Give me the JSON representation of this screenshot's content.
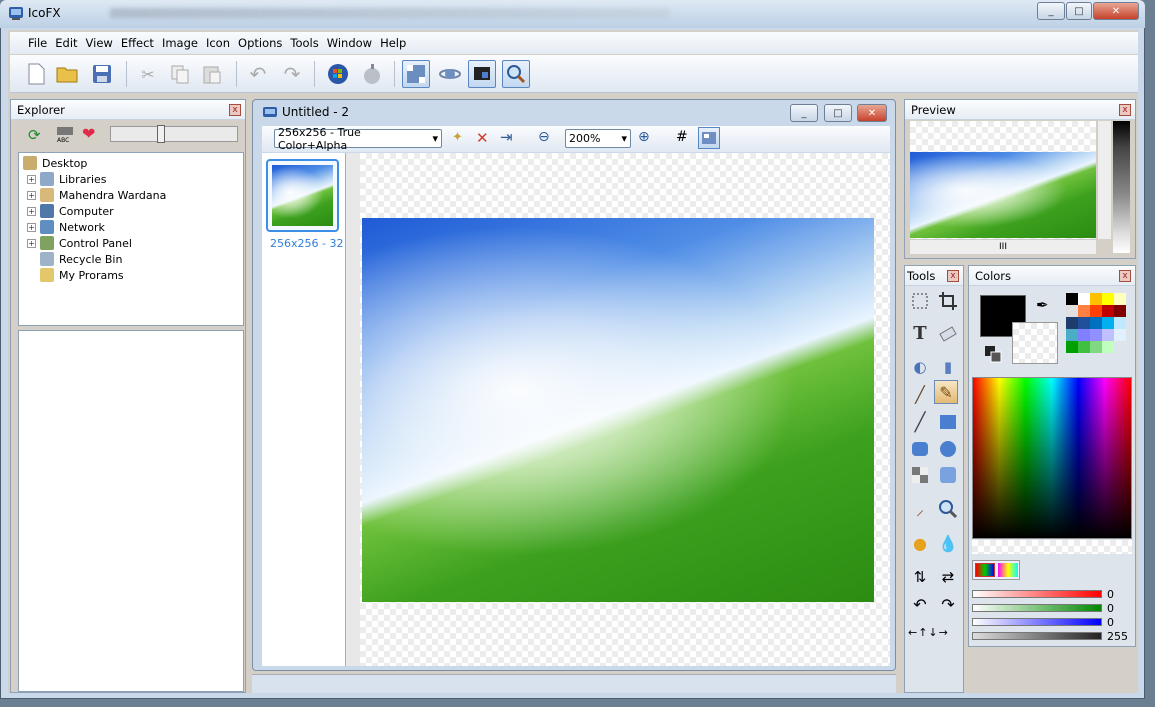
{
  "window": {
    "title": "IcoFX",
    "controls": [
      "_",
      "□",
      "✕"
    ]
  },
  "menu": [
    "File",
    "Edit",
    "View",
    "Effect",
    "Image",
    "Icon",
    "Options",
    "Tools",
    "Window",
    "Help"
  ],
  "toolbar": {
    "icons": [
      "new-icon",
      "open-icon",
      "save-icon",
      "cut-icon",
      "copy-icon",
      "paste-icon",
      "undo-icon",
      "redo-icon",
      "windows-icon",
      "apple-icon",
      "icon-mode-icon",
      "satellite-icon",
      "screen-capture-icon",
      "zoom-icon"
    ]
  },
  "explorer": {
    "title": "Explorer",
    "tree": [
      {
        "label": "Desktop",
        "level": 0,
        "expander": false
      },
      {
        "label": "Libraries",
        "level": 1,
        "expander": true
      },
      {
        "label": "Mahendra Wardana",
        "level": 1,
        "expander": true
      },
      {
        "label": "Computer",
        "level": 1,
        "expander": true
      },
      {
        "label": "Network",
        "level": 1,
        "expander": true
      },
      {
        "label": "Control Panel",
        "level": 1,
        "expander": true
      },
      {
        "label": "Recycle Bin",
        "level": 1,
        "expander": false
      },
      {
        "label": "My Prorams",
        "level": 1,
        "expander": false
      }
    ]
  },
  "document": {
    "title": "Untitled - 2",
    "format_select": "256x256 - True Color+Alpha",
    "zoom_select": "200%",
    "thumbnail_caption": "256x256 - 32"
  },
  "preview": {
    "title": "Preview",
    "hscroll_grip": "III"
  },
  "tools": {
    "title": "Tools"
  },
  "colors": {
    "title": "Colors",
    "primary": "#000000",
    "red": "0",
    "green": "0",
    "blue": "0",
    "alpha": "255",
    "palette": [
      "#000000",
      "#ffffff",
      "#ffc000",
      "#ffff00",
      "#ffffc0",
      "#e0e0e0",
      "#ff8040",
      "#ff4000",
      "#c00000",
      "#800000",
      "#1f3c6e",
      "#20509a",
      "#0070c0",
      "#00b0f0",
      "#c0e8ff",
      "#4bacc6",
      "#7f7fff",
      "#9090ff",
      "#c0c0ff",
      "#e0f0ff",
      "#00a000",
      "#40c040",
      "#80d880",
      "#c0ffc0"
    ]
  }
}
